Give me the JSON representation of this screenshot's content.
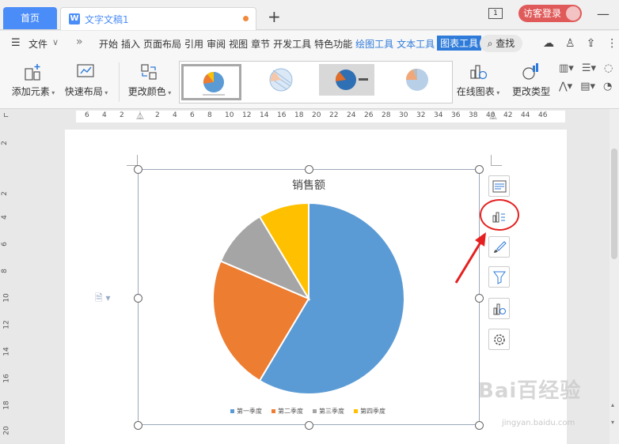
{
  "titlebar": {
    "home_tab": "首页",
    "doc_tab": "文字文稿1",
    "new_tab": "+",
    "window_number": "1",
    "visitor_login": "访客登录"
  },
  "menubar": {
    "file": "文件",
    "more": "»",
    "items": [
      "开始",
      "插入",
      "页面布局",
      "引用",
      "审阅",
      "视图",
      "章节",
      "开发工具",
      "特色功能",
      "绘图工具",
      "文本工具",
      "图表工具"
    ],
    "active_item": "图表工具",
    "search": "查找"
  },
  "toolbar": {
    "add_element": "添加元素",
    "quick_layout": "快速布局",
    "change_color": "更改颜色",
    "online_chart": "在线图表",
    "change_type": "更改类型"
  },
  "ruler": {
    "top": [
      "6",
      "4",
      "2",
      "2",
      "4",
      "6",
      "8",
      "10",
      "12",
      "14",
      "16",
      "18",
      "20",
      "22",
      "24",
      "26",
      "28",
      "30",
      "32",
      "34",
      "36",
      "38",
      "40",
      "42",
      "44",
      "46"
    ],
    "left": [
      "2",
      "2",
      "4",
      "6",
      "8",
      "10",
      "12",
      "14",
      "16",
      "18",
      "20"
    ]
  },
  "chart_data": {
    "type": "pie",
    "title": "销售额",
    "categories": [
      "第一季度",
      "第二季度",
      "第三季度",
      "第四季度"
    ],
    "values": [
      8.2,
      3.2,
      1.4,
      1.2
    ],
    "colors": [
      "#5b9bd5",
      "#ed7d31",
      "#a5a5a5",
      "#ffc000"
    ],
    "legend_position": "bottom"
  },
  "side_tools": [
    "chart-elements-icon",
    "chart-quick-layout-icon",
    "chart-style-brush-icon",
    "chart-filter-icon",
    "online-chart-icon",
    "chart-settings-icon"
  ],
  "watermark": {
    "text": "Bai百经验",
    "sub": "jingyan.baidu.com"
  }
}
